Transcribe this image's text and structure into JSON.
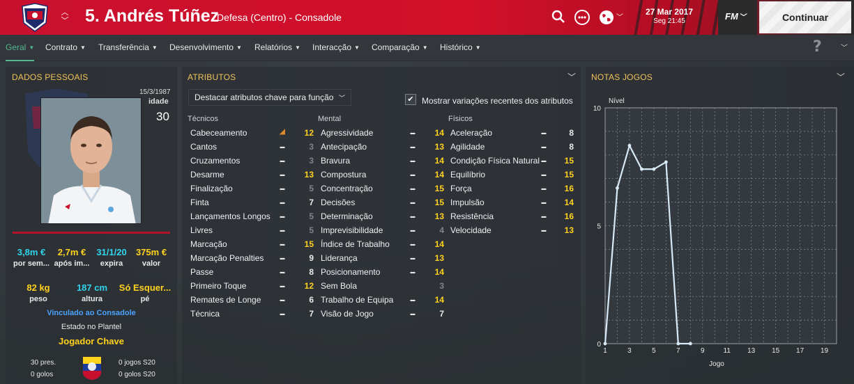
{
  "header": {
    "player_name": "5. Andrés Túñez",
    "subtitle": "Defesa (Centro) - Consadole",
    "date": "27 Mar 2017",
    "time": "Seg 21:45",
    "fm_label": "FM",
    "continue_label": "Continuar"
  },
  "nav": {
    "items": [
      "Geral",
      "Contrato",
      "Transferência",
      "Desenvolvimento",
      "Relatórios",
      "Interacção",
      "Comparação",
      "Histórico"
    ],
    "help": "?"
  },
  "personal": {
    "title": "DADOS PESSOAIS",
    "dob": "15/3/1987",
    "age_label": "idade",
    "age": "30",
    "stats": [
      {
        "value": "3,8m €",
        "label": "por sem..."
      },
      {
        "value": "2,7m €",
        "label": "após im..."
      },
      {
        "value": "31/1/20",
        "label": "expira"
      },
      {
        "value": "375m €",
        "label": "valor"
      }
    ],
    "body": [
      {
        "value": "82 kg",
        "label": "peso"
      },
      {
        "value": "187 cm",
        "label": "altura"
      },
      {
        "value": "Só Esquer...",
        "label": "pé"
      }
    ],
    "club_link": "Vinculado ao Consadole",
    "squad_status_label": "Estado no Plantel",
    "squad_status": "Jogador Chave",
    "caps": "30 pres.",
    "goals": "0 golos",
    "u20_caps": "0 jogos S20",
    "u20_goals": "0 golos S20"
  },
  "attributes": {
    "title": "ATRIBUTOS",
    "dropdown": "Destacar atributos chave para função",
    "checkbox_label": "Mostrar variações recentes dos atributos",
    "columns": [
      "Técnicos",
      "Mental",
      "Físicos"
    ],
    "technical": [
      {
        "name": "Cabeceamento",
        "trend": "up",
        "value": "12",
        "tone": "yellow"
      },
      {
        "name": "Cantos",
        "trend": "flat",
        "value": "3",
        "tone": "grey"
      },
      {
        "name": "Cruzamentos",
        "trend": "flat",
        "value": "3",
        "tone": "grey"
      },
      {
        "name": "Desarme",
        "trend": "flat",
        "value": "13",
        "tone": "yellow"
      },
      {
        "name": "Finalização",
        "trend": "flat",
        "value": "5",
        "tone": "grey"
      },
      {
        "name": "Finta",
        "trend": "flat",
        "value": "7",
        "tone": "white"
      },
      {
        "name": "Lançamentos Longos",
        "trend": "flat",
        "value": "5",
        "tone": "grey"
      },
      {
        "name": "Livres",
        "trend": "flat",
        "value": "5",
        "tone": "grey"
      },
      {
        "name": "Marcação",
        "trend": "flat",
        "value": "15",
        "tone": "yellow"
      },
      {
        "name": "Marcação Penalties",
        "trend": "flat",
        "value": "9",
        "tone": "white"
      },
      {
        "name": "Passe",
        "trend": "flat",
        "value": "8",
        "tone": "white"
      },
      {
        "name": "Primeiro Toque",
        "trend": "flat",
        "value": "12",
        "tone": "yellow"
      },
      {
        "name": "Remates de Longe",
        "trend": "flat",
        "value": "6",
        "tone": "white"
      },
      {
        "name": "Técnica",
        "trend": "flat",
        "value": "7",
        "tone": "white"
      }
    ],
    "mental": [
      {
        "name": "Agressividade",
        "trend": "flat",
        "value": "14",
        "tone": "yellow"
      },
      {
        "name": "Antecipação",
        "trend": "flat",
        "value": "13",
        "tone": "yellow"
      },
      {
        "name": "Bravura",
        "trend": "flat",
        "value": "14",
        "tone": "yellow"
      },
      {
        "name": "Compostura",
        "trend": "flat",
        "value": "14",
        "tone": "yellow"
      },
      {
        "name": "Concentração",
        "trend": "flat",
        "value": "15",
        "tone": "yellow"
      },
      {
        "name": "Decisões",
        "trend": "flat",
        "value": "15",
        "tone": "yellow"
      },
      {
        "name": "Determinação",
        "trend": "flat",
        "value": "13",
        "tone": "yellow"
      },
      {
        "name": "Imprevisibilidade",
        "trend": "flat",
        "value": "4",
        "tone": "grey"
      },
      {
        "name": "Índice de Trabalho",
        "trend": "flat",
        "value": "14",
        "tone": "yellow"
      },
      {
        "name": "Liderança",
        "trend": "flat",
        "value": "13",
        "tone": "yellow"
      },
      {
        "name": "Posicionamento",
        "trend": "flat",
        "value": "14",
        "tone": "yellow"
      },
      {
        "name": "Sem Bola",
        "trend": "none",
        "value": "3",
        "tone": "grey"
      },
      {
        "name": "Trabalho de Equipa",
        "trend": "flat",
        "value": "14",
        "tone": "yellow"
      },
      {
        "name": "Visão de Jogo",
        "trend": "flat",
        "value": "7",
        "tone": "white"
      }
    ],
    "physical": [
      {
        "name": "Aceleração",
        "trend": "flat",
        "value": "8",
        "tone": "white"
      },
      {
        "name": "Agilidade",
        "trend": "flat",
        "value": "8",
        "tone": "white"
      },
      {
        "name": "Condição Física Natural",
        "trend": "flat",
        "value": "15",
        "tone": "yellow"
      },
      {
        "name": "Equilíbrio",
        "trend": "flat",
        "value": "15",
        "tone": "yellow"
      },
      {
        "name": "Força",
        "trend": "flat",
        "value": "16",
        "tone": "yellow"
      },
      {
        "name": "Impulsão",
        "trend": "flat",
        "value": "14",
        "tone": "yellow"
      },
      {
        "name": "Resistência",
        "trend": "flat",
        "value": "16",
        "tone": "yellow"
      },
      {
        "name": "Velocidade",
        "trend": "flat",
        "value": "13",
        "tone": "yellow"
      }
    ]
  },
  "ratings": {
    "title": "NOTAS JOGOS"
  },
  "chart_data": {
    "type": "line",
    "title": "",
    "xlabel": "Jogo",
    "ylabel": "Nível",
    "xlim": [
      1,
      20
    ],
    "ylim": [
      0,
      10
    ],
    "x_ticks": [
      1,
      3,
      5,
      7,
      9,
      11,
      13,
      15,
      17,
      19
    ],
    "y_ticks": [
      0,
      5,
      10
    ],
    "grid": true,
    "series": [
      {
        "x": [
          1,
          2,
          3,
          4,
          5,
          6,
          7,
          8
        ],
        "values": [
          0,
          6.6,
          8.4,
          7.4,
          7.4,
          7.7,
          0,
          0
        ]
      }
    ],
    "line_color": "#d8e9f7"
  }
}
